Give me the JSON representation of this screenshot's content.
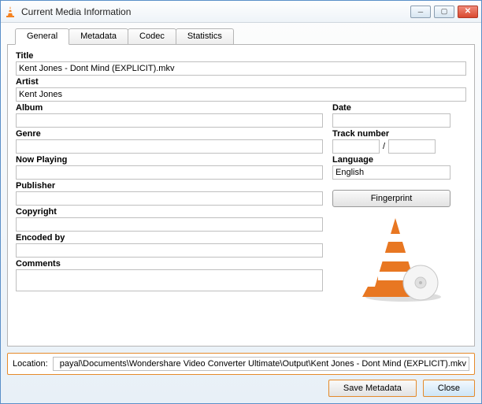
{
  "window": {
    "title": "Current Media Information"
  },
  "tabs": {
    "general": "General",
    "metadata": "Metadata",
    "codec": "Codec",
    "statistics": "Statistics"
  },
  "labels": {
    "title": "Title",
    "artist": "Artist",
    "album": "Album",
    "genre": "Genre",
    "now_playing": "Now Playing",
    "publisher": "Publisher",
    "copyright": "Copyright",
    "encoded_by": "Encoded by",
    "comments": "Comments",
    "date": "Date",
    "track_number": "Track number",
    "language": "Language",
    "location": "Location:",
    "fingerprint": "Fingerprint",
    "save_metadata": "Save Metadata",
    "close": "Close",
    "track_sep": "/"
  },
  "values": {
    "title": "Kent Jones - Dont Mind (EXPLICIT).mkv",
    "artist": "Kent Jones",
    "album": "",
    "genre": "",
    "now_playing": "",
    "publisher": "",
    "copyright": "",
    "encoded_by": "",
    "comments": "",
    "date": "",
    "track_a": "",
    "track_b": "",
    "language": "English",
    "location": "payal\\Documents\\Wondershare Video Converter Ultimate\\Output\\Kent Jones - Dont Mind (EXPLICIT).mkv"
  }
}
